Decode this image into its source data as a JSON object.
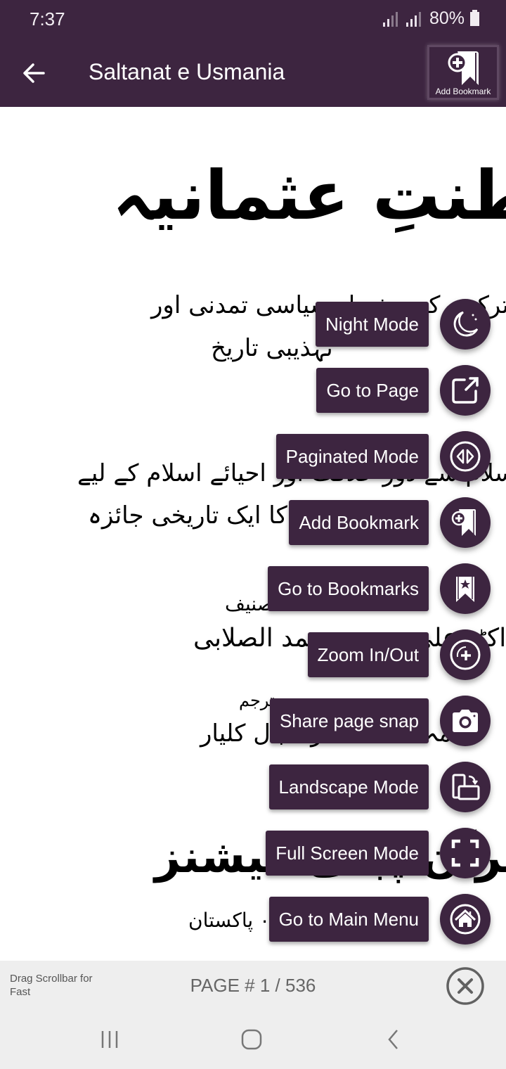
{
  "status_bar": {
    "time": "7:37",
    "battery_percent": "80%"
  },
  "app_bar": {
    "title": "Saltanat e Usmania",
    "back_icon": "arrow-left-icon",
    "add_bookmark_label": "Add Bookmark"
  },
  "page_content": {
    "title": "سلطنتِ عثمانیہ",
    "subtitle_line1": "ترکوں کی مفصل سیاسی تمدنی اور",
    "subtitle_line2": "تہذیبی تاریخ",
    "line3": "قبول اسلام سے دور خلافت اور احیائے اسلام کے لیے",
    "line4": "تحریکوں تک کا ایک تاریخی جائزہ",
    "author_label": "تصنیف",
    "author": "ڈاکٹر علی محمد محمد الصلابی",
    "translator_label": "مترجم",
    "translator": "علامہ محمد ظفر اقبال کلیار",
    "publisher": "ضیاء القرآن پبلی کیشنز",
    "city": "لاہور ۔ کراچی ۰ پاکستان"
  },
  "fab_menu": {
    "items": [
      {
        "label": "Night Mode",
        "icon": "moon-icon"
      },
      {
        "label": "Go to Page",
        "icon": "open-external-icon"
      },
      {
        "label": "Paginated Mode",
        "icon": "paginate-arrows-icon"
      },
      {
        "label": "Add Bookmark",
        "icon": "bookmark-add-icon"
      },
      {
        "label": "Go to Bookmarks",
        "icon": "bookmark-star-icon"
      },
      {
        "label": "Zoom In/Out",
        "icon": "zoom-icon"
      },
      {
        "label": "Share page snap",
        "icon": "camera-icon"
      },
      {
        "label": "Landscape Mode",
        "icon": "rotate-screen-icon"
      },
      {
        "label": "Full Screen Mode",
        "icon": "fullscreen-icon"
      },
      {
        "label": "Go to Main Menu",
        "icon": "home-icon"
      }
    ]
  },
  "bottom_bar": {
    "drag_hint": "Drag Scrollbar for Fast",
    "page_indicator": "PAGE # 1 / 536",
    "current_page": 1,
    "total_pages": 536
  },
  "colors": {
    "primary": "#3d2540",
    "on_primary": "#ffffff",
    "bottom_bar_bg": "#eeeeee",
    "bottom_text": "#666666"
  }
}
